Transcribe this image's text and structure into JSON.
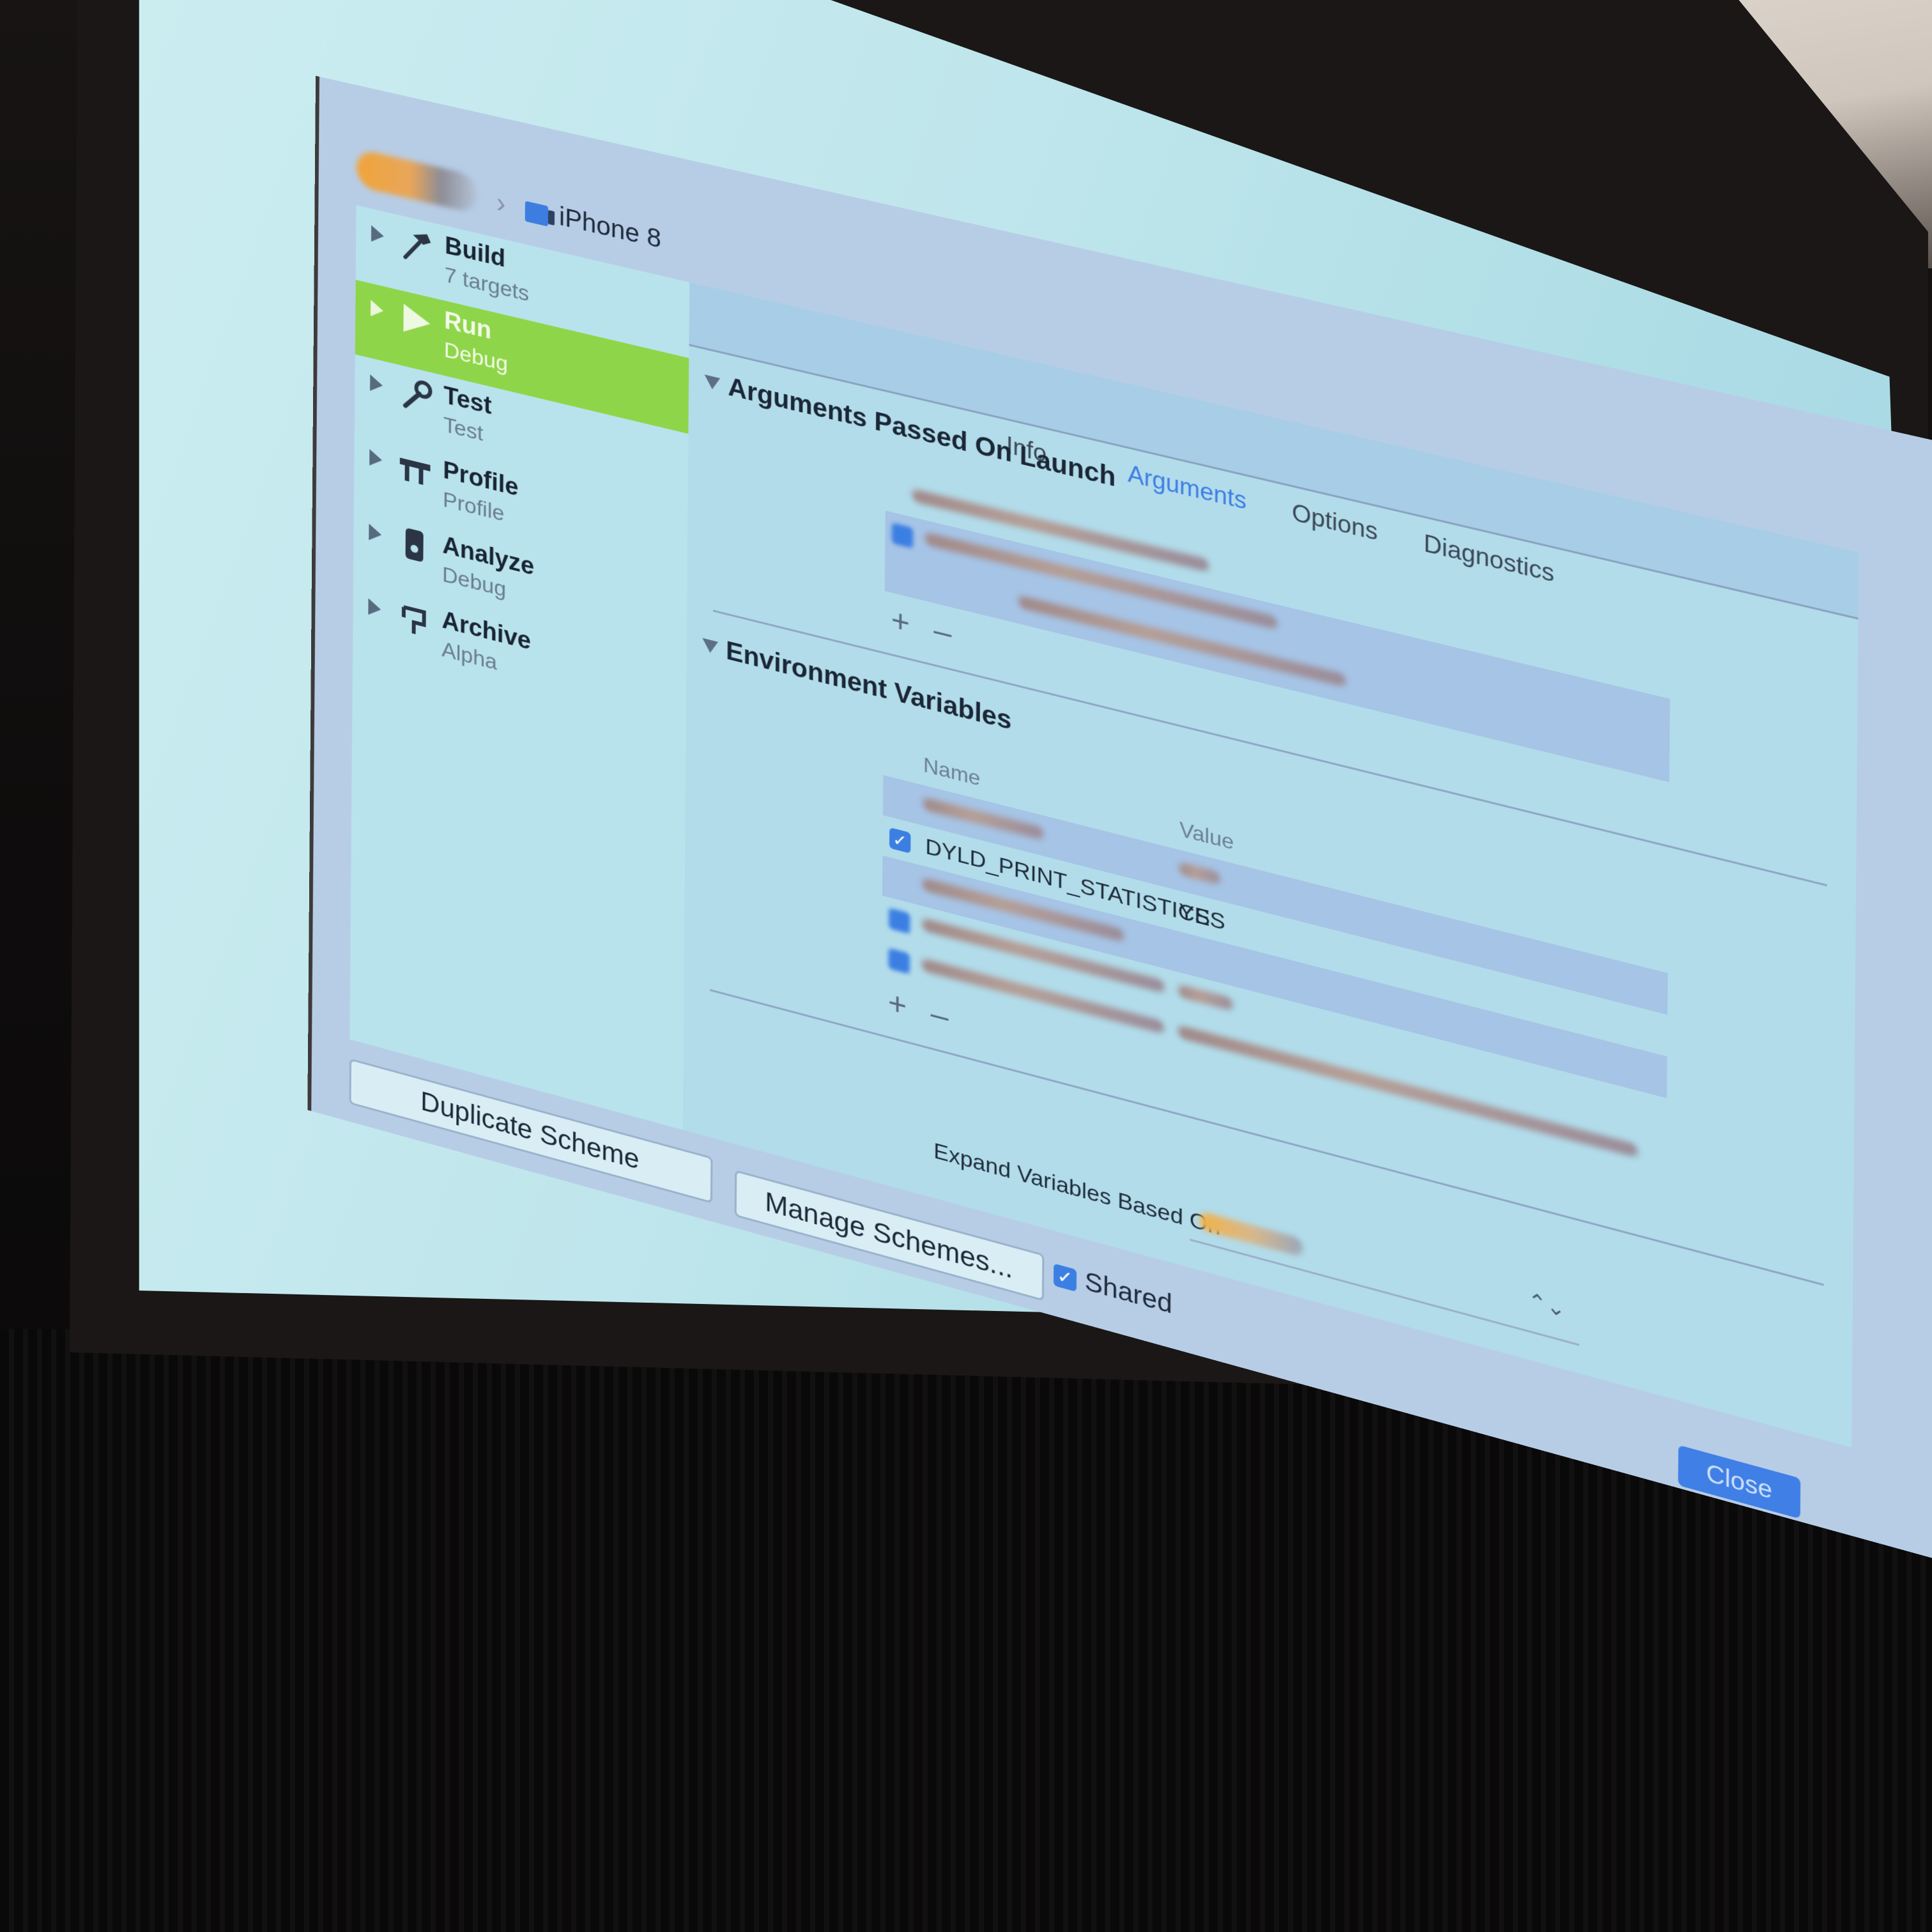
{
  "titlebar": {
    "destination": "iPhone 8"
  },
  "sidebar": {
    "items": [
      {
        "title": "Build",
        "subtitle": "7 targets",
        "icon": "hammer-icon"
      },
      {
        "title": "Run",
        "subtitle": "Debug",
        "icon": "play-icon"
      },
      {
        "title": "Test",
        "subtitle": "Test",
        "icon": "wrench-icon"
      },
      {
        "title": "Profile",
        "subtitle": "Profile",
        "icon": "gauge-icon"
      },
      {
        "title": "Analyze",
        "subtitle": "Debug",
        "icon": "analyze-icon"
      },
      {
        "title": "Archive",
        "subtitle": "Alpha",
        "icon": "archive-icon"
      }
    ],
    "selected_index": 1
  },
  "tabs": {
    "items": [
      "Info",
      "Arguments",
      "Options",
      "Diagnostics"
    ],
    "active": "Arguments"
  },
  "arguments": {
    "heading": "Arguments Passed On Launch"
  },
  "environment": {
    "heading": "Environment Variables",
    "col_name": "Name",
    "col_value": "Value",
    "visible_row": {
      "name": "DYLD_PRINT_STATISTICS",
      "value": "YES",
      "checked": true
    }
  },
  "expand": {
    "label": "Expand Variables Based On"
  },
  "footer": {
    "duplicate_label": "Duplicate Scheme",
    "manage_label": "Manage Schemes...",
    "shared_label": "Shared",
    "shared_checked": true,
    "close_label": "Close"
  },
  "controls": {
    "add_symbol": "+",
    "remove_symbol": "–",
    "check_symbol": "✓",
    "popup_arrows": "⌃⌄"
  },
  "colors": {
    "selected_row": "#8fd54a",
    "accent": "#3d7ee6"
  }
}
